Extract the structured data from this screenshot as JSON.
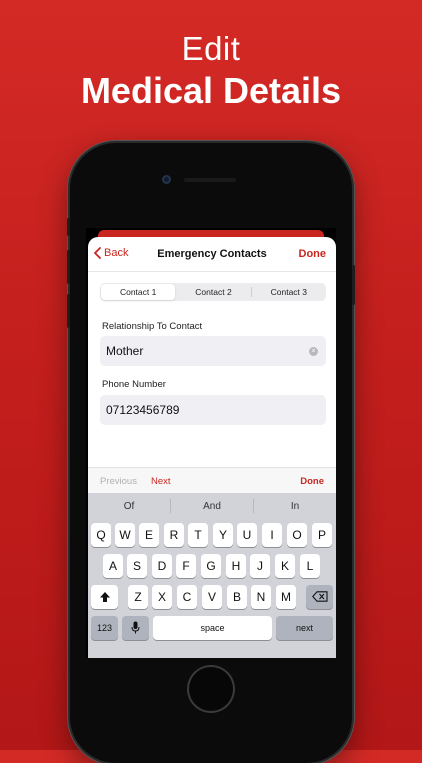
{
  "headline": {
    "line1": "Edit",
    "line2": "Medical Details"
  },
  "nav": {
    "back_label": "Back",
    "title": "Emergency Contacts",
    "done_label": "Done"
  },
  "segments": [
    "Contact 1",
    "Contact 2",
    "Contact 3"
  ],
  "segment_selected": "Contact 1",
  "fields": {
    "relationship": {
      "label": "Relationship To Contact",
      "value": "Mother"
    },
    "phone": {
      "label": "Phone Number",
      "value": "07123456789"
    }
  },
  "accessory": {
    "previous_label": "Previous",
    "next_label": "Next",
    "done_label": "Done"
  },
  "suggestions": [
    "Of",
    "And",
    "In"
  ],
  "keyboard": {
    "row1": [
      "Q",
      "W",
      "E",
      "R",
      "T",
      "Y",
      "U",
      "I",
      "O",
      "P"
    ],
    "row2": [
      "A",
      "S",
      "D",
      "F",
      "G",
      "H",
      "J",
      "K",
      "L"
    ],
    "row3": [
      "Z",
      "X",
      "C",
      "V",
      "B",
      "N",
      "M"
    ],
    "numbers_label": "123",
    "space_label": "space",
    "next_label": "next"
  },
  "colors": {
    "accent": "#c9261f",
    "background": "#c41f1d"
  }
}
